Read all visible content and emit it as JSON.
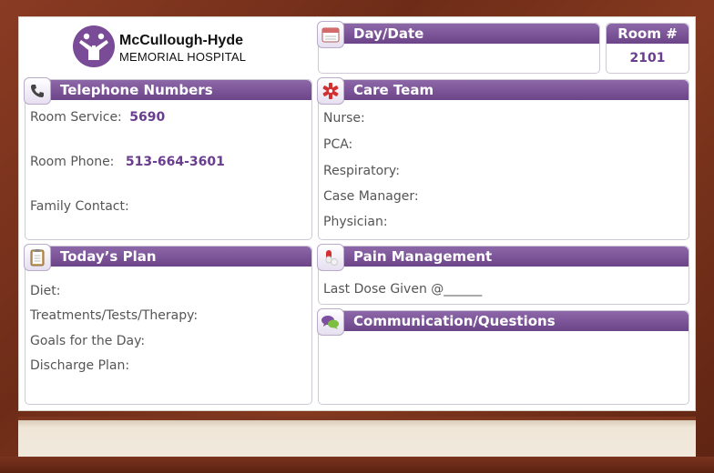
{
  "hospital": {
    "name": "McCullough-Hyde",
    "subtitle": "MEMORIAL HOSPITAL"
  },
  "day_date": {
    "title": "Day/Date",
    "icon": "calendar-icon"
  },
  "room": {
    "title": "Room #",
    "number": "2101"
  },
  "telephone": {
    "title": "Telephone Numbers",
    "icon": "phone-icon",
    "room_service_label": "Room Service:",
    "room_service_value": "5690",
    "room_phone_label": "Room Phone:",
    "room_phone_value": "513-664-3601",
    "family_contact_label": "Family Contact:"
  },
  "care_team": {
    "title": "Care Team",
    "icon": "medical-star-icon",
    "items": [
      "Nurse:",
      "PCA:",
      "Respiratory:",
      "Case Manager:",
      "Physician:"
    ]
  },
  "todays_plan": {
    "title": "Today’s Plan",
    "icon": "clipboard-icon",
    "items": [
      "Diet:",
      "Treatments/Tests/Therapy:",
      "Goals for the Day:",
      "Discharge Plan:"
    ]
  },
  "pain_management": {
    "title": "Pain Management",
    "icon": "pill-icon",
    "last_dose": "Last Dose Given @______"
  },
  "communication": {
    "title": "Communication/Questions",
    "icon": "speech-bubbles-icon"
  },
  "colors": {
    "header_purple": "#6c4489",
    "value_purple": "#6a3d8f",
    "frame_wood": "#6e2c18"
  }
}
